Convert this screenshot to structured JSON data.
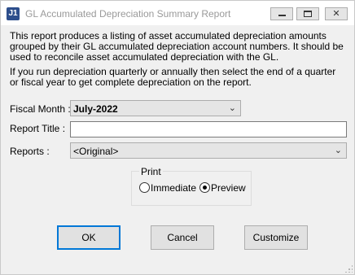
{
  "window": {
    "icon_text": "J1",
    "title": "GL Accumulated Depreciation Summary Report",
    "controls": {
      "minimize": "minimize",
      "maximize": "maximize",
      "close": "✕"
    }
  },
  "description": {
    "paragraph1": "This report produces a listing of asset accumulated depreciation amounts grouped by their GL accumulated depreciation account numbers.  It should be used to reconcile asset accumulated depreciation with the GL.",
    "paragraph2": "If you run depreciation quarterly or annually then select the end of a quarter or fiscal year to get complete depreciation on the report."
  },
  "form": {
    "fiscal_month_label": "Fiscal Month :",
    "fiscal_month_value": "July-2022",
    "report_title_label": "Report Title :",
    "report_title_value": "",
    "reports_label": "Reports :",
    "reports_value": "<Original>"
  },
  "print": {
    "group_label": "Print",
    "immediate_label": "Immediate",
    "preview_label": "Preview",
    "selected": "Preview"
  },
  "buttons": {
    "ok": "OK",
    "cancel": "Cancel",
    "customize": "Customize"
  }
}
